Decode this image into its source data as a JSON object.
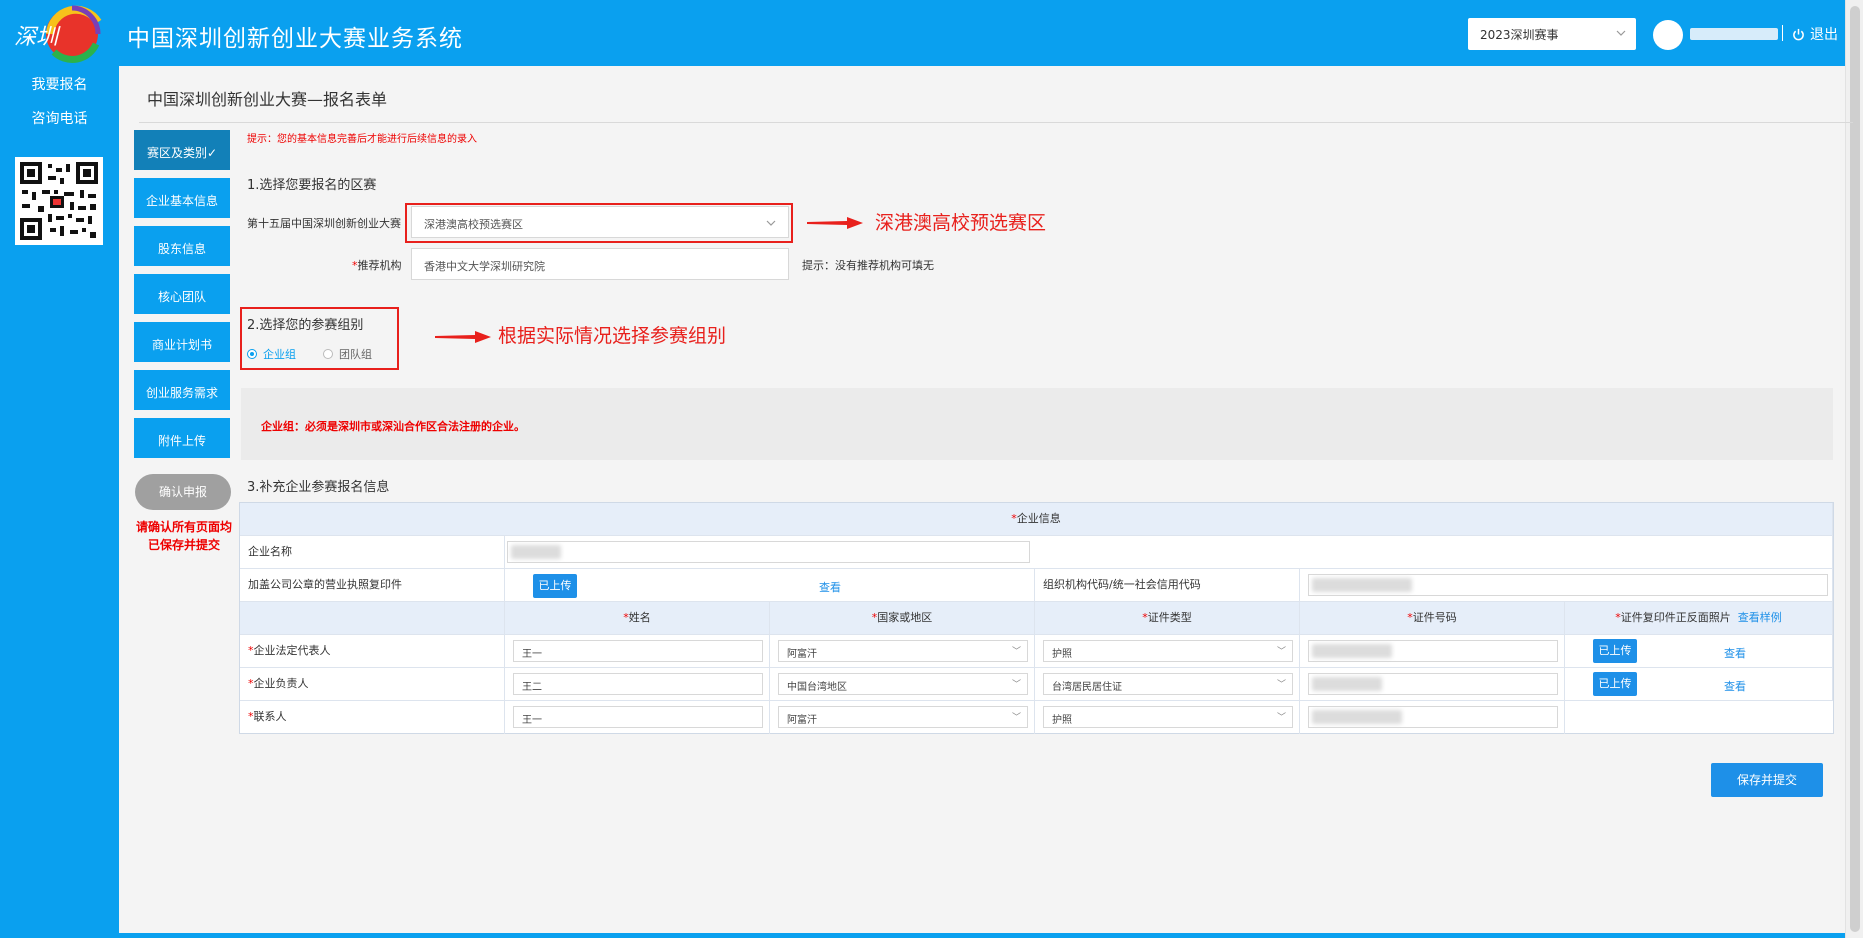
{
  "header": {
    "logo_text": "深圳",
    "app_title": "中国深圳创新创业大赛业务系统",
    "season_select": "2023深圳赛事",
    "logout_label": "退出"
  },
  "sidebar": {
    "items": [
      {
        "label": "我要报名"
      },
      {
        "label": "咨询电话"
      }
    ]
  },
  "main": {
    "page_title": "中国深圳创新创业大赛—报名表单",
    "steps": [
      {
        "label": "赛区及类别✓"
      },
      {
        "label": "企业基本信息"
      },
      {
        "label": "股东信息"
      },
      {
        "label": "核心团队"
      },
      {
        "label": "商业计划书"
      },
      {
        "label": "创业服务需求"
      },
      {
        "label": "附件上传"
      }
    ],
    "submit_label": "确认申报",
    "submit_note": "请确认所有页面均已保存并提交",
    "tip": "提示：您的基本信息完善后才能进行后续信息的录入",
    "section1_title": "1.选择您要报名的区赛",
    "competition_label": "第十五届中国深圳创新创业大赛",
    "competition_value": "深港澳高校预选赛区",
    "recommender_label": "推荐机构",
    "recommender_value": "香港中文大学深圳研究院",
    "recommender_hint": "提示：没有推荐机构可填无",
    "annotation1": "深港澳高校预选赛区",
    "section2_title": "2.选择您的参赛组别",
    "group_options": [
      {
        "label": "企业组",
        "selected": true
      },
      {
        "label": "团队组",
        "selected": false
      }
    ],
    "annotation2": "根据实际情况选择参赛组别",
    "notice": "企业组：必须是深圳市或深汕合作区合法注册的企业。",
    "section3_title": "3.补充企业参赛报名信息",
    "save_label": "保存并提交"
  },
  "table": {
    "title": "企业信息",
    "company_name_label": "企业名称",
    "license_label": "加盖公司公章的营业执照复印件",
    "uploaded_label": "已上传",
    "view_label": "查看",
    "org_code_label": "组织机构代码/统一社会信用代码",
    "columns": [
      "姓名",
      "国家或地区",
      "证件类型",
      "证件号码",
      "证件复印件正反面照片"
    ],
    "sample_link": "查看样例",
    "rows": [
      {
        "role": "企业法定代表人",
        "name": "王一",
        "region": "阿富汗",
        "id_type": "护照",
        "has_upload": true
      },
      {
        "role": "企业负责人",
        "name": "王二",
        "region": "中国台湾地区",
        "id_type": "台湾居民居住证",
        "has_upload": true
      },
      {
        "role": "联系人",
        "name": "王一",
        "region": "阿富汗",
        "id_type": "护照",
        "has_upload": false
      }
    ]
  },
  "colors": {
    "brand": "#0aa0ef",
    "active_step": "#1280b8",
    "annotation": "#e8201c",
    "link": "#1e90e8"
  }
}
